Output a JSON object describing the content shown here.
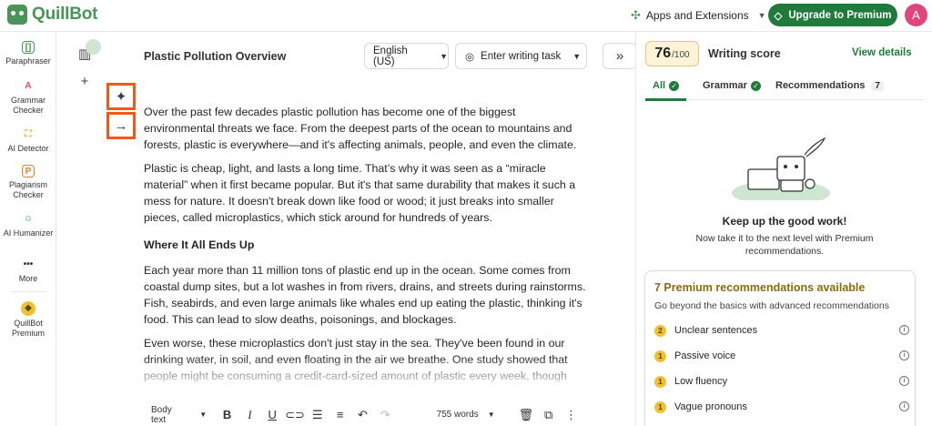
{
  "app": {
    "name": "QuillBot"
  },
  "header": {
    "apps_label": "Apps and Extensions",
    "upgrade_label": "Upgrade to Premium",
    "avatar_initial": "A"
  },
  "nav": {
    "items": [
      {
        "label": "Paraphraser",
        "icon": "paraphraser-icon",
        "color": "#499557"
      },
      {
        "label": "Grammar Checker",
        "icon": "grammar-checker-icon",
        "color": "#e0457b"
      },
      {
        "label": "AI Detector",
        "icon": "ai-detector-icon",
        "color": "#f39c12"
      },
      {
        "label": "Plagiarism Checker",
        "icon": "plagiarism-checker-icon",
        "color": "#f07c30"
      },
      {
        "label": "AI Humanizer",
        "icon": "ai-humanizer-icon",
        "color": "#2e9b6f"
      },
      {
        "label": "More",
        "icon": "more-icon",
        "color": "#333333"
      },
      {
        "label": "QuillBot Premium",
        "icon": "premium-diamond-icon",
        "color": "#f0c12e"
      }
    ]
  },
  "editor": {
    "title": "Plastic Pollution Overview",
    "language": "English (US)",
    "task_placeholder": "Enter writing task",
    "paragraphs": [
      "Over the past few decades plastic pollution has become one of the biggest environmental threats we face. From the deepest parts of the ocean to mountains and forests, plastic is everywhere—and it's affecting animals, people, and even the climate.",
      "Plastic is cheap, light, and lasts a long time. That’s why it was seen as a “miracle material” when it first became popular. But it's that same durability that makes it such a mess for nature. It doesn't break down like food or wood; it just breaks into smaller pieces, called microplastics, which stick around for hundreds of years."
    ],
    "heading": "Where It All Ends Up",
    "paragraphs2": [
      "Each year more than 11 million tons of plastic end up in the ocean. Some comes from coastal dump sites, but a lot washes in from rivers, drains, and streets during rainstorms. Fish, seabirds, and even large animals like whales end up eating the plastic, thinking it's food. This can lead to slow deaths, poisonings, and blockages.",
      "Even worse, these microplastics don't just stay in the sea. They've been found in our drinking water, in soil, and even floating in the air we breathe. One study showed that people might be consuming a credit-card-sized amount of plastic every week, though"
    ],
    "toolbar": {
      "style": "Body text",
      "word_count": "755 words"
    }
  },
  "panel": {
    "score": "76",
    "score_max": "/100",
    "score_label": "Writing score",
    "view_details": "View details",
    "tabs": {
      "all": "All",
      "grammar": "Grammar",
      "recommendations": "Recommendations",
      "recommendations_count": "7"
    },
    "keep_title": "Keep up the good work!",
    "keep_sub": "Now take it to the next level with Premium recommendations.",
    "premium": {
      "title": "7 Premium recommendations available",
      "subtitle": "Go beyond the basics with advanced recommendations",
      "items": [
        {
          "count": "2",
          "label": "Unclear sentences"
        },
        {
          "count": "1",
          "label": "Passive voice"
        },
        {
          "count": "1",
          "label": "Low fluency"
        },
        {
          "count": "1",
          "label": "Vague pronouns"
        }
      ]
    }
  }
}
